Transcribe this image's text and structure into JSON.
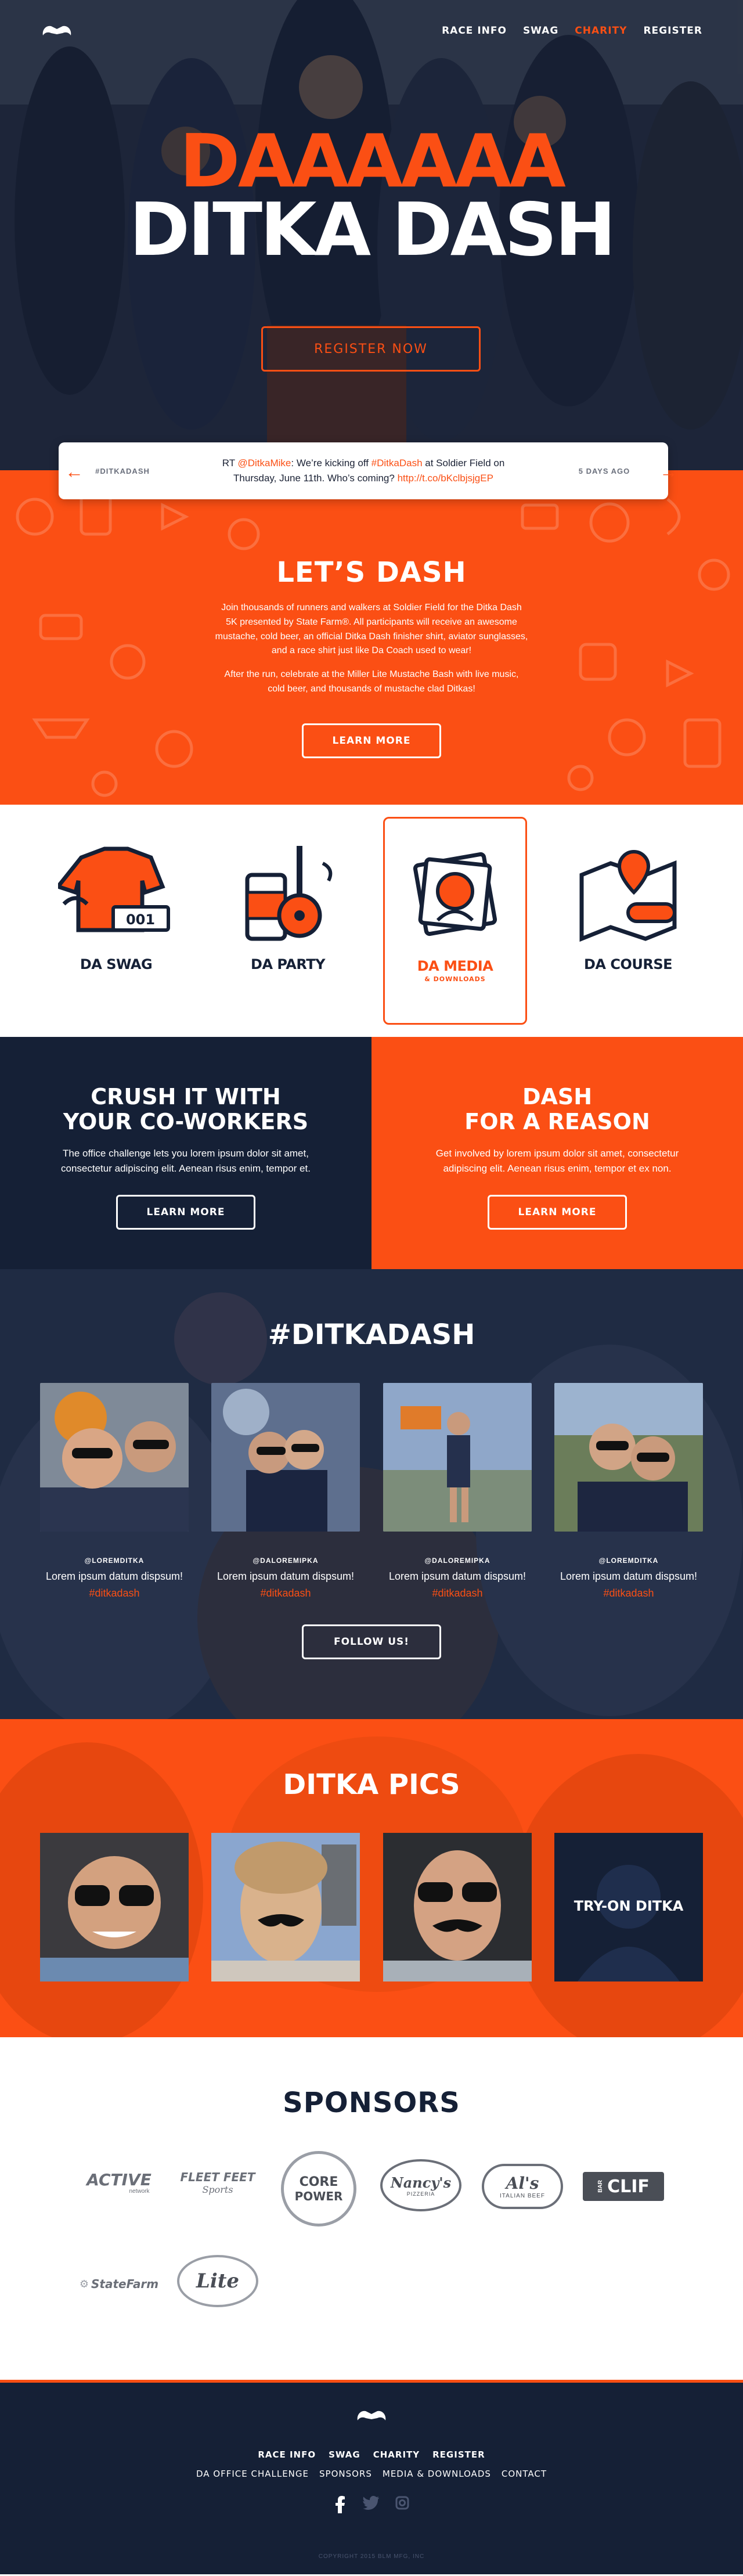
{
  "nav": {
    "items": [
      {
        "label": "RACE INFO"
      },
      {
        "label": "SWAG"
      },
      {
        "label": "CHARITY"
      },
      {
        "label": "REGISTER"
      }
    ]
  },
  "hero": {
    "title_line1": "DAAAAAA",
    "title_line2": "DITKA DASH",
    "register_label": "REGISTER NOW"
  },
  "tweet": {
    "tag": "#DITKADASH",
    "rt": "RT ",
    "handle": "@DitkaMike",
    "text_a": ": We’re kicking off ",
    "hashtag": "#DitkaDash",
    "text_b": " at Soldier Field on",
    "text_c": "Thursday, June 11th. Who’s coming? ",
    "link": "http://t.co/bKclbjsjgEP",
    "time": "5 DAYS AGO"
  },
  "lets_dash": {
    "title": "LET’S DASH",
    "para1": "Join thousands of runners and walkers at Soldier Field for the Ditka Dash 5K presented by State Farm®. All participants will receive an awesome mustache, cold beer, an official Ditka Dash finisher shirt, aviator sunglasses, and a race shirt just like Da Coach used to wear!",
    "para2": "After the run, celebrate at the Miller Lite Mustache Bash with live music, cold beer, and thousands of mustache clad Ditkas!",
    "button": "LEARN MORE"
  },
  "tiles": [
    {
      "label": "DA SWAG",
      "icon": "jersey-icon"
    },
    {
      "label": "DA PARTY",
      "icon": "guitar-icon"
    },
    {
      "label": "DA MEDIA",
      "sub": "& DOWNLOADS",
      "icon": "photos-icon"
    },
    {
      "label": "DA COURSE",
      "icon": "map-icon"
    }
  ],
  "split": {
    "left_title_1": "CRUSH IT WITH",
    "left_title_2": "YOUR CO-WORKERS",
    "left_text": "The office challenge lets you lorem ipsum dolor sit amet, consectetur adipiscing elit. Aenean risus enim, tempor et.",
    "left_button": "LEARN MORE",
    "right_title_1": "DASH",
    "right_title_2": "FOR A REASON",
    "right_text": "Get involved by lorem ipsum dolor sit amet, consectetur adipiscing elit. Aenean risus enim, tempor et ex non.",
    "right_button": "LEARN MORE"
  },
  "social": {
    "title": "#DITKADASH",
    "posts": [
      {
        "handle": "@LOREMDITKA",
        "caption": "Lorem ipsum datum dispsum!",
        "hashtag": "#ditkadash"
      },
      {
        "handle": "@DALOREMIPKA",
        "caption": "Lorem ipsum datum dispsum!",
        "hashtag": "#ditkadash"
      },
      {
        "handle": "@DALOREMIPKA",
        "caption": "Lorem ipsum datum dispsum!",
        "hashtag": "#ditkadash"
      },
      {
        "handle": "@LOREMDITKA",
        "caption": "Lorem ipsum datum dispsum!",
        "hashtag": "#ditkadash"
      }
    ],
    "button": "FOLLOW US!"
  },
  "pics": {
    "title": "DITKA PICS",
    "try_on": "TRY-ON DITKA"
  },
  "sponsors": {
    "title": "SPONSORS",
    "logos": [
      {
        "name": "ACTIVE",
        "sub": "network"
      },
      {
        "name": "FLEET FEET",
        "sub": "Sports"
      },
      {
        "name": "CORE",
        "sub": "POWER"
      },
      {
        "name": "Nancy's",
        "sub": "PIZZERIA"
      },
      {
        "name": "Al's",
        "sub": "ITALIAN BEEF"
      },
      {
        "name": "CLIF",
        "sub": "BAR"
      },
      {
        "name": "StateFarm"
      },
      {
        "name": "Lite"
      }
    ]
  },
  "footer": {
    "links1": [
      {
        "label": "RACE INFO"
      },
      {
        "label": "SWAG"
      },
      {
        "label": "CHARITY"
      },
      {
        "label": "REGISTER"
      }
    ],
    "links2": [
      {
        "label": "DA OFFICE CHALLENGE"
      },
      {
        "label": "SPONSORS"
      },
      {
        "label": "MEDIA & DOWNLOADS"
      },
      {
        "label": "CONTACT"
      }
    ],
    "copyright": "COPYRIGHT 2015 BLM MFG, INC"
  },
  "colors": {
    "orange": "#fb4f14",
    "navy": "#152036"
  }
}
